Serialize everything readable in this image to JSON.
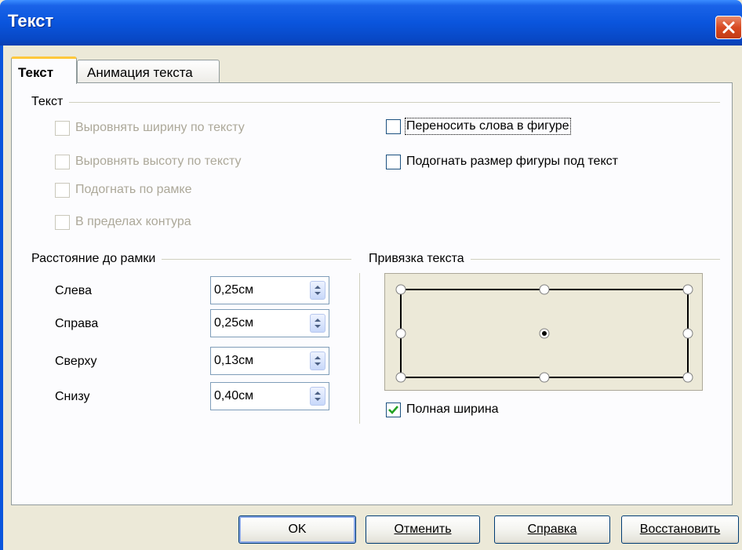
{
  "window": {
    "title": "Текст"
  },
  "tabs": [
    {
      "label": "Текст",
      "active": true
    },
    {
      "label": "Анимация текста",
      "active": false
    }
  ],
  "text_section": {
    "label": "Текст",
    "left_options": [
      {
        "label": "Выровнять ширину по тексту",
        "checked": false,
        "enabled": false
      },
      {
        "label": "Выровнять высоту по тексту",
        "checked": false,
        "enabled": false
      },
      {
        "label": "Подогнать по рамке",
        "checked": false,
        "enabled": false
      },
      {
        "label": "В пределах контура",
        "checked": false,
        "enabled": false
      }
    ],
    "right_options": [
      {
        "label": "Переносить слова в фигуре",
        "checked": false,
        "enabled": true
      },
      {
        "label": "Подогнать размер фигуры под текст",
        "checked": false,
        "enabled": true
      }
    ]
  },
  "spacing": {
    "label": "Расстояние до рамки",
    "fields": [
      {
        "label": "Слева",
        "value": "0,25см"
      },
      {
        "label": "Справа",
        "value": "0,25см"
      },
      {
        "label": "Сверху",
        "value": "0,13см"
      },
      {
        "label": "Снизу",
        "value": "0,40см"
      }
    ]
  },
  "anchor": {
    "label": "Привязка текста",
    "selected": "center",
    "full_width": {
      "label": "Полная ширина",
      "checked": true
    }
  },
  "buttons": {
    "ok": "OK",
    "cancel": "Отменить",
    "help": "Справка",
    "reset": "Восстановить"
  },
  "colors": {
    "title_bar": "#0a55dd",
    "dialog_bg": "#ece9d8",
    "check_mark": "#21a121",
    "disabled_text": "#aca899"
  }
}
